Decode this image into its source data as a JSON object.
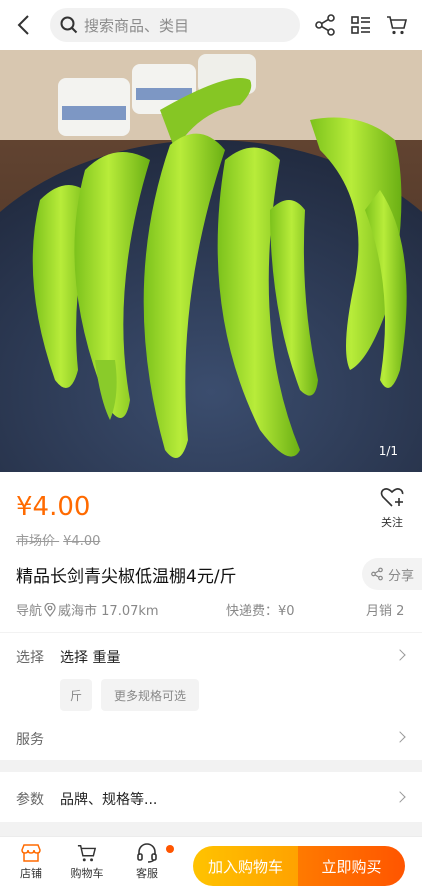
{
  "search": {
    "placeholder": "搜索商品、类目"
  },
  "gallery": {
    "counter": "1/1",
    "image_desc": "green-pepper-product-photo"
  },
  "product": {
    "price": "¥4.00",
    "market_label": "市场价",
    "market_price": "¥4.00",
    "follow_label": "关注",
    "title": "精品长剑青尖椒低温棚4元/斤",
    "share_label": "分享",
    "nav_label": "导航",
    "location": "威海市 17.07km",
    "shipping": "快递费：¥0",
    "monthly_sales": "月销 2"
  },
  "spec": {
    "label": "选择",
    "value": "选择 重量",
    "options": [
      "斤",
      "更多规格可选"
    ]
  },
  "service": {
    "label": "服务"
  },
  "params": {
    "label": "参数",
    "value": "品牌、规格等..."
  },
  "bottom_bar": {
    "shop": "店铺",
    "cart": "购物车",
    "service": "客服",
    "add_to_cart": "加入购物车",
    "buy_now": "立即购买"
  },
  "colors": {
    "accent": "#ff6a00",
    "cart_btn": "#ffb400",
    "buy_btn": "#ff6000"
  }
}
